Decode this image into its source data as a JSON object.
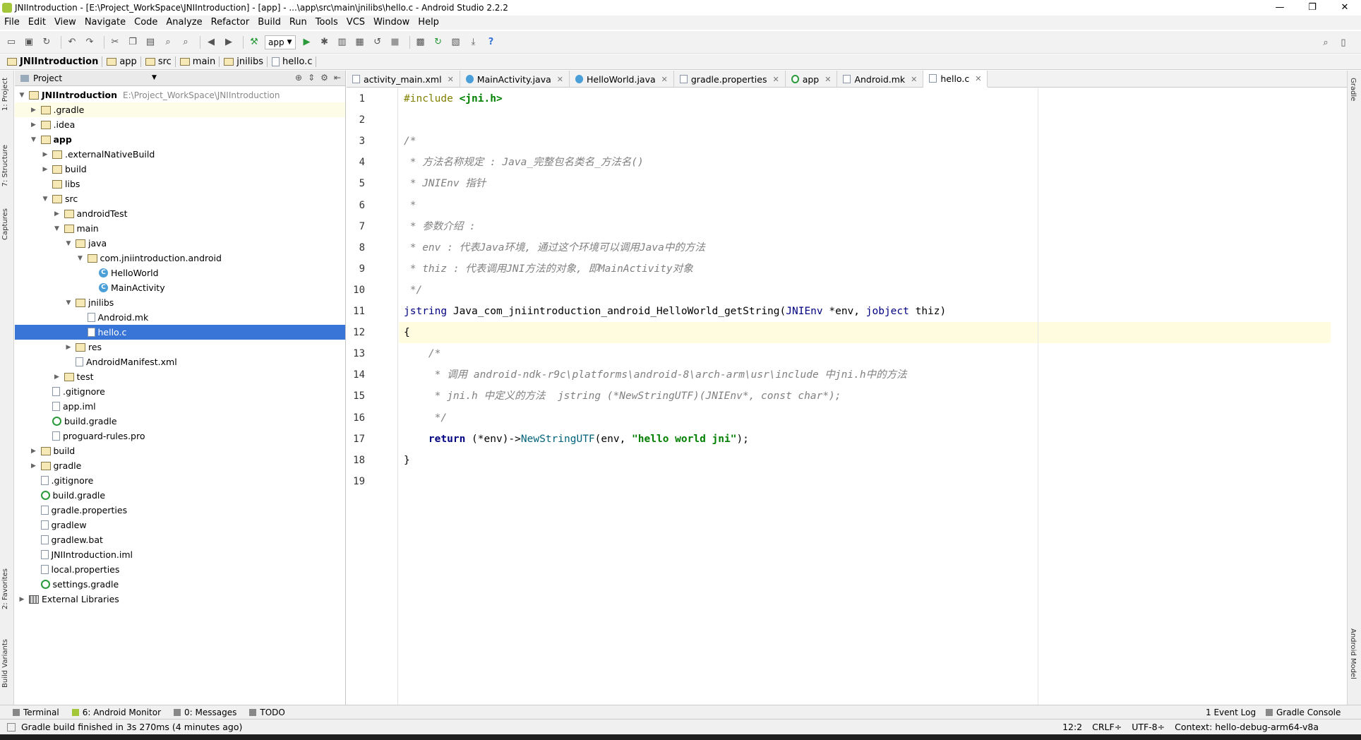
{
  "window": {
    "title": "JNIIntroduction - [E:\\Project_WorkSpace\\JNIIntroduction] - [app] - ...\\app\\src\\main\\jnilibs\\hello.c - Android Studio 2.2.2",
    "controls": [
      "—",
      "❐",
      "✕"
    ]
  },
  "menu": [
    "File",
    "Edit",
    "View",
    "Navigate",
    "Code",
    "Analyze",
    "Refactor",
    "Build",
    "Run",
    "Tools",
    "VCS",
    "Window",
    "Help"
  ],
  "toolbar": {
    "run_config": "app",
    "help": "?"
  },
  "breadcrumb": [
    "JNIIntroduction",
    "app",
    "src",
    "main",
    "jnilibs",
    "hello.c"
  ],
  "left_tool_windows": [
    "1: Project",
    "7: Structure",
    "Captures",
    "2: Favorites",
    "Build Variants"
  ],
  "right_tool_windows": [
    "Gradle",
    "Android Model"
  ],
  "project_panel": {
    "view_selector": "Project",
    "tree": [
      {
        "label": "JNIIntroduction",
        "path": "E:\\Project_WorkSpace\\JNIIntroduction",
        "depth": 0,
        "arrow": "▼",
        "icon": "folder",
        "bold": true
      },
      {
        "label": ".gradle",
        "depth": 1,
        "arrow": "▶",
        "icon": "folder",
        "highlight": true
      },
      {
        "label": ".idea",
        "depth": 1,
        "arrow": "▶",
        "icon": "folder"
      },
      {
        "label": "app",
        "depth": 1,
        "arrow": "▼",
        "icon": "folder",
        "bold": true
      },
      {
        "label": ".externalNativeBuild",
        "depth": 2,
        "arrow": "▶",
        "icon": "folder"
      },
      {
        "label": "build",
        "depth": 2,
        "arrow": "▶",
        "icon": "folder"
      },
      {
        "label": "libs",
        "depth": 2,
        "arrow": "",
        "icon": "folder"
      },
      {
        "label": "src",
        "depth": 2,
        "arrow": "▼",
        "icon": "folder"
      },
      {
        "label": "androidTest",
        "depth": 3,
        "arrow": "▶",
        "icon": "folder"
      },
      {
        "label": "main",
        "depth": 3,
        "arrow": "▼",
        "icon": "folder"
      },
      {
        "label": "java",
        "depth": 4,
        "arrow": "▼",
        "icon": "folder"
      },
      {
        "label": "com.jniintroduction.android",
        "depth": 5,
        "arrow": "▼",
        "icon": "folder"
      },
      {
        "label": "HelloWorld",
        "depth": 6,
        "arrow": "",
        "icon": "class"
      },
      {
        "label": "MainActivity",
        "depth": 6,
        "arrow": "",
        "icon": "class"
      },
      {
        "label": "jnilibs",
        "depth": 4,
        "arrow": "▼",
        "icon": "folder"
      },
      {
        "label": "Android.mk",
        "depth": 5,
        "arrow": "",
        "icon": "file"
      },
      {
        "label": "hello.c",
        "depth": 5,
        "arrow": "",
        "icon": "file",
        "selected": true
      },
      {
        "label": "res",
        "depth": 4,
        "arrow": "▶",
        "icon": "folder"
      },
      {
        "label": "AndroidManifest.xml",
        "depth": 4,
        "arrow": "",
        "icon": "file"
      },
      {
        "label": "test",
        "depth": 3,
        "arrow": "▶",
        "icon": "folder"
      },
      {
        "label": ".gitignore",
        "depth": 2,
        "arrow": "",
        "icon": "file"
      },
      {
        "label": "app.iml",
        "depth": 2,
        "arrow": "",
        "icon": "file"
      },
      {
        "label": "build.gradle",
        "depth": 2,
        "arrow": "",
        "icon": "gradle"
      },
      {
        "label": "proguard-rules.pro",
        "depth": 2,
        "arrow": "",
        "icon": "file"
      },
      {
        "label": "build",
        "depth": 1,
        "arrow": "▶",
        "icon": "folder"
      },
      {
        "label": "gradle",
        "depth": 1,
        "arrow": "▶",
        "icon": "folder"
      },
      {
        "label": ".gitignore",
        "depth": 1,
        "arrow": "",
        "icon": "file"
      },
      {
        "label": "build.gradle",
        "depth": 1,
        "arrow": "",
        "icon": "gradle"
      },
      {
        "label": "gradle.properties",
        "depth": 1,
        "arrow": "",
        "icon": "file"
      },
      {
        "label": "gradlew",
        "depth": 1,
        "arrow": "",
        "icon": "file"
      },
      {
        "label": "gradlew.bat",
        "depth": 1,
        "arrow": "",
        "icon": "file"
      },
      {
        "label": "JNIIntroduction.iml",
        "depth": 1,
        "arrow": "",
        "icon": "file"
      },
      {
        "label": "local.properties",
        "depth": 1,
        "arrow": "",
        "icon": "file"
      },
      {
        "label": "settings.gradle",
        "depth": 1,
        "arrow": "",
        "icon": "gradle"
      },
      {
        "label": "External Libraries",
        "depth": 0,
        "arrow": "▶",
        "icon": "lib"
      }
    ]
  },
  "editor_tabs": [
    {
      "label": "activity_main.xml",
      "icon": "file"
    },
    {
      "label": "MainActivity.java",
      "icon": "class"
    },
    {
      "label": "HelloWorld.java",
      "icon": "class"
    },
    {
      "label": "gradle.properties",
      "icon": "file"
    },
    {
      "label": "app",
      "icon": "gradle"
    },
    {
      "label": "Android.mk",
      "icon": "file"
    },
    {
      "label": "hello.c",
      "icon": "file",
      "active": true
    }
  ],
  "code_lines": [
    [
      {
        "t": "#include ",
        "c": "pp"
      },
      {
        "t": "<jni.h>",
        "c": "str"
      }
    ],
    [],
    [
      {
        "t": "/*",
        "c": "cm"
      }
    ],
    [
      {
        "t": " * 方法名称规定 : Java_完整包名类名_方法名()",
        "c": "cm"
      }
    ],
    [
      {
        "t": " * JNIEnv 指针",
        "c": "cm"
      }
    ],
    [
      {
        "t": " *",
        "c": "cm"
      }
    ],
    [
      {
        "t": " * 参数介绍 :",
        "c": "cm"
      }
    ],
    [
      {
        "t": " * env : 代表Java环境, 通过这个环境可以调用Java中的方法",
        "c": "cm"
      }
    ],
    [
      {
        "t": " * thiz : 代表调用JNI方法的对象, 即MainActivity对象",
        "c": "cm"
      }
    ],
    [
      {
        "t": " */",
        "c": "cm"
      }
    ],
    [
      {
        "t": "jstring",
        "c": "ty"
      },
      {
        "t": " Java_com_jniintroduction_android_HelloWorld_getString(",
        "c": ""
      },
      {
        "t": "JNIEnv",
        "c": "ty"
      },
      {
        "t": " *env, ",
        "c": ""
      },
      {
        "t": "jobject",
        "c": "ty"
      },
      {
        "t": " thiz)",
        "c": ""
      }
    ],
    [
      {
        "t": "{",
        "c": ""
      }
    ],
    [
      {
        "t": "    /*",
        "c": "cm"
      }
    ],
    [
      {
        "t": "     * 调用 android-ndk-r9c\\platforms\\android-8\\arch-arm\\usr\\include 中jni.h中的方法",
        "c": "cm"
      }
    ],
    [
      {
        "t": "     * jni.h 中定义的方法  jstring (*NewStringUTF)(JNIEnv*, const char*);",
        "c": "cm"
      }
    ],
    [
      {
        "t": "     */",
        "c": "cm"
      }
    ],
    [
      {
        "t": "    ",
        "c": ""
      },
      {
        "t": "return",
        "c": "kw"
      },
      {
        "t": " (*env)->",
        "c": ""
      },
      {
        "t": "NewStringUTF",
        "c": "fn"
      },
      {
        "t": "(env, ",
        "c": ""
      },
      {
        "t": "\"hello world jni\"",
        "c": "str"
      },
      {
        "t": ");",
        "c": ""
      }
    ],
    [
      {
        "t": "}",
        "c": ""
      }
    ],
    []
  ],
  "caret_line": 12,
  "bottom_tools": [
    "Terminal",
    "6: Android Monitor",
    "0: Messages",
    "TODO"
  ],
  "bottom_tools_right": [
    "1 Event Log",
    "Gradle Console"
  ],
  "status": {
    "message": "Gradle build finished in 3s 270ms (4 minutes ago)",
    "position": "12:2",
    "line_sep": "CRLF÷",
    "encoding": "UTF-8÷",
    "context": "Context: hello-debug-arm64-v8a"
  },
  "colors": {
    "selection": "#3875d7",
    "caret_row": "#fffce0",
    "comment": "#808080",
    "keyword": "#000080",
    "string": "#008000"
  }
}
